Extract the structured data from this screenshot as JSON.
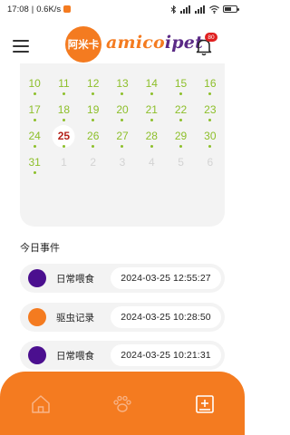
{
  "status_bar": {
    "time": "17:08",
    "speed": "0.6K/s",
    "battery": "49"
  },
  "header": {
    "logo_text": "阿米卡",
    "brand_main": "amico",
    "brand_accent": "ipet",
    "notification_count": "80",
    "icons": [
      "menu-icon",
      "bell-icon"
    ]
  },
  "calendar": {
    "days": [
      {
        "n": "10",
        "dot": true,
        "state": "normal"
      },
      {
        "n": "11",
        "dot": true,
        "state": "normal"
      },
      {
        "n": "12",
        "dot": true,
        "state": "normal"
      },
      {
        "n": "13",
        "dot": true,
        "state": "normal"
      },
      {
        "n": "14",
        "dot": true,
        "state": "normal"
      },
      {
        "n": "15",
        "dot": true,
        "state": "normal"
      },
      {
        "n": "16",
        "dot": true,
        "state": "normal"
      },
      {
        "n": "17",
        "dot": true,
        "state": "normal"
      },
      {
        "n": "18",
        "dot": true,
        "state": "normal"
      },
      {
        "n": "19",
        "dot": true,
        "state": "normal"
      },
      {
        "n": "20",
        "dot": true,
        "state": "normal"
      },
      {
        "n": "21",
        "dot": true,
        "state": "normal"
      },
      {
        "n": "22",
        "dot": true,
        "state": "normal"
      },
      {
        "n": "23",
        "dot": true,
        "state": "normal"
      },
      {
        "n": "24",
        "dot": true,
        "state": "normal"
      },
      {
        "n": "25",
        "dot": true,
        "state": "today"
      },
      {
        "n": "26",
        "dot": true,
        "state": "normal"
      },
      {
        "n": "27",
        "dot": true,
        "state": "normal"
      },
      {
        "n": "28",
        "dot": true,
        "state": "normal"
      },
      {
        "n": "29",
        "dot": true,
        "state": "normal"
      },
      {
        "n": "30",
        "dot": true,
        "state": "normal"
      },
      {
        "n": "31",
        "dot": true,
        "state": "normal"
      },
      {
        "n": "1",
        "dot": false,
        "state": "other"
      },
      {
        "n": "2",
        "dot": false,
        "state": "other"
      },
      {
        "n": "3",
        "dot": false,
        "state": "other"
      },
      {
        "n": "4",
        "dot": false,
        "state": "other"
      },
      {
        "n": "5",
        "dot": false,
        "state": "other"
      },
      {
        "n": "6",
        "dot": false,
        "state": "other"
      }
    ]
  },
  "events": {
    "title": "今日事件",
    "items": [
      {
        "label": "日常喂食",
        "time": "2024-03-25 12:55:27",
        "color": "#4b0f8f"
      },
      {
        "label": "驱虫记录",
        "time": "2024-03-25 10:28:50",
        "color": "#f47b20"
      },
      {
        "label": "日常喂食",
        "time": "2024-03-25 10:21:31",
        "color": "#4b0f8f"
      }
    ]
  },
  "bottom_nav": {
    "items": [
      "home-icon",
      "paw-icon",
      "add-record-icon"
    ]
  },
  "colors": {
    "accent": "#f47b20",
    "brand_purple": "#5b2a86",
    "day_green": "#8dbf2a",
    "today_red": "#b5231b"
  }
}
